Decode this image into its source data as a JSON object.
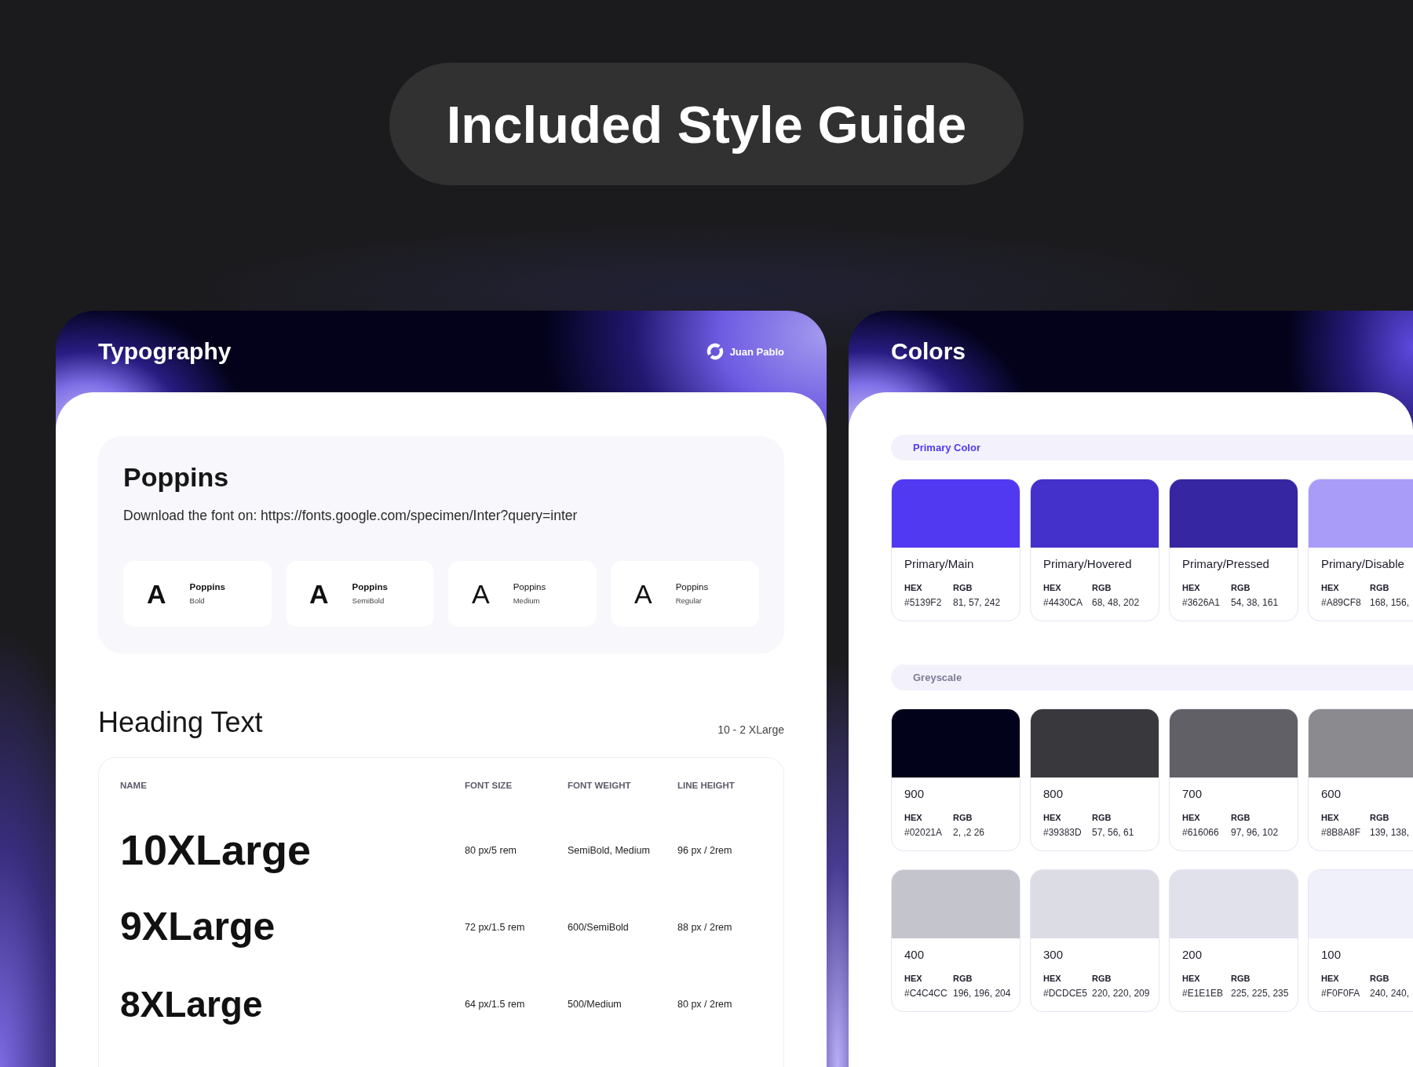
{
  "title": "Included Style Guide",
  "typography": {
    "title": "Typography",
    "author": "Juan Pablo",
    "font": {
      "name": "Poppins",
      "download": "Download the font on: https://fonts.google.com/specimen/Inter?query=inter",
      "weights": [
        {
          "sample": "A",
          "family": "Poppins",
          "style": "Bold",
          "kind": "bold"
        },
        {
          "sample": "A",
          "family": "Poppins",
          "style": "SemiBold",
          "kind": "semibold"
        },
        {
          "sample": "A",
          "family": "Poppins",
          "style": "Medium",
          "kind": "medium"
        },
        {
          "sample": "A",
          "family": "Poppins",
          "style": "Regular",
          "kind": "regular"
        }
      ]
    },
    "heading": {
      "title": "Heading Text",
      "range": "10 - 2 XLarge",
      "table": {
        "columns": [
          "NAME",
          "FONT SIZE",
          "FONT WEIGHT",
          "LINE HEIGHT"
        ],
        "rows": [
          [
            "10XLarge",
            "80 px/5 rem",
            "SemiBold, Medium",
            "96 px / 2rem"
          ],
          [
            "9XLarge",
            "72 px/1.5 rem",
            "600/SemiBold",
            "88 px / 2rem"
          ],
          [
            "8XLarge",
            "64 px/1.5 rem",
            "500/Medium",
            "80 px / 2rem"
          ]
        ]
      }
    }
  },
  "colors": {
    "title": "Colors",
    "sections": [
      {
        "label": "Primary Color",
        "color": "#5139f2",
        "swatches": [
          {
            "name": "Primary/Main",
            "color": "#5139f2",
            "hex_label": "HEX",
            "hex": "#5139F2",
            "rgb_label": "RGB",
            "rgb": "81, 57, 242"
          },
          {
            "name": "Primary/Hovered",
            "color": "#4430ca",
            "hex_label": "HEX",
            "hex": "#4430CA",
            "rgb_label": "RGB",
            "rgb": "68, 48, 202"
          },
          {
            "name": "Primary/Pressed",
            "color": "#3626a1",
            "hex_label": "HEX",
            "hex": "#3626A1",
            "rgb_label": "RGB",
            "rgb": "54, 38, 161"
          },
          {
            "name": "Primary/Disable",
            "color": "#a89cf8",
            "hex_label": "HEX",
            "hex": "#A89CF8",
            "rgb_label": "RGB",
            "rgb": "168, 156,"
          }
        ]
      },
      {
        "label": "Greyscale",
        "color": "#7c7b93",
        "swatches": [
          {
            "name": "900",
            "color": "#02021a",
            "hex_label": "HEX",
            "hex": "#02021A",
            "rgb_label": "RGB",
            "rgb": "2, ,2 26"
          },
          {
            "name": "800",
            "color": "#39383d",
            "hex_label": "HEX",
            "hex": "#39383D",
            "rgb_label": "RGB",
            "rgb": "57, 56, 61"
          },
          {
            "name": "700",
            "color": "#616066",
            "hex_label": "HEX",
            "hex": "#616066",
            "rgb_label": "RGB",
            "rgb": "97, 96, 102"
          },
          {
            "name": "600",
            "color": "#8b8a8f",
            "hex_label": "HEX",
            "hex": "#8B8A8F",
            "rgb_label": "RGB",
            "rgb": "139, 138,"
          },
          {
            "name": "400",
            "color": "#c4c4cc",
            "hex_label": "HEX",
            "hex": "#C4C4CC",
            "rgb_label": "RGB",
            "rgb": "196, 196, 204"
          },
          {
            "name": "300",
            "color": "#dcdce5",
            "hex_label": "HEX",
            "hex": "#DCDCE5",
            "rgb_label": "RGB",
            "rgb": "220, 220, 209"
          },
          {
            "name": "200",
            "color": "#e1e1eb",
            "hex_label": "HEX",
            "hex": "#E1E1EB",
            "rgb_label": "RGB",
            "rgb": "225, 225, 235"
          },
          {
            "name": "100",
            "color": "#f0f0fa",
            "hex_label": "HEX",
            "hex": "#F0F0FA",
            "rgb_label": "RGB",
            "rgb": "240, 240,"
          }
        ]
      }
    ]
  }
}
